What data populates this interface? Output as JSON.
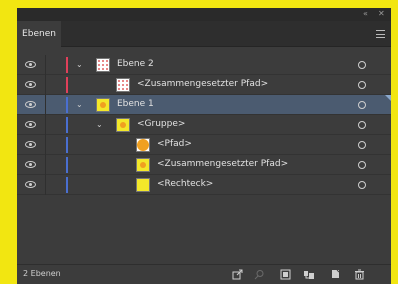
{
  "panel": {
    "tab_label": "Ebenen",
    "footer_label": "2 Ebenen"
  },
  "colors": {
    "layer2": "#e0405a",
    "layer1": "#4a6fd0",
    "selection": "#4b5b70"
  },
  "layers": [
    {
      "label": "Ebene 2",
      "level": 0,
      "expanded": true,
      "selected": false,
      "color": "#e0405a",
      "thumb": "pattern"
    },
    {
      "label": "<Zusammengesetzter Pfad>",
      "level": 1,
      "expanded": null,
      "selected": false,
      "color": "#e0405a",
      "thumb": "pattern"
    },
    {
      "label": "Ebene 1",
      "level": 0,
      "expanded": true,
      "selected": true,
      "color": "#4a6fd0",
      "thumb": "yellow-dot"
    },
    {
      "label": "<Gruppe>",
      "level": 1,
      "expanded": true,
      "selected": false,
      "color": "#4a6fd0",
      "thumb": "yellow-dot"
    },
    {
      "label": "<Pfad>",
      "level": 2,
      "expanded": null,
      "selected": false,
      "color": "#4a6fd0",
      "thumb": "orange-circle"
    },
    {
      "label": "<Zusammengesetzter Pfad>",
      "level": 2,
      "expanded": null,
      "selected": false,
      "color": "#4a6fd0",
      "thumb": "yellow-dot"
    },
    {
      "label": "<Rechteck>",
      "level": 2,
      "expanded": null,
      "selected": false,
      "color": "#4a6fd0",
      "thumb": "yellow"
    }
  ],
  "icons": {
    "collapse": "collapse-icon",
    "close": "close-icon",
    "menu": "panel-menu-icon",
    "export": "export-icon",
    "search": "search-icon",
    "clipping_mask": "clipping-mask-icon",
    "new_sublayer": "new-sublayer-icon",
    "new_layer": "new-layer-icon",
    "delete": "trash-icon"
  }
}
